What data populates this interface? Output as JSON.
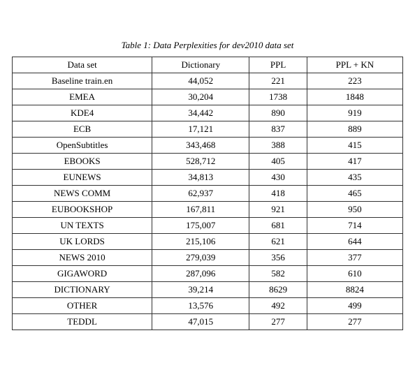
{
  "caption": "Table 1: Data Perplexities for dev2010 data set",
  "columns": [
    "Data set",
    "Dictionary",
    "PPL",
    "PPL + KN"
  ],
  "rows": [
    [
      "Baseline train.en",
      "44,052",
      "221",
      "223"
    ],
    [
      "EMEA",
      "30,204",
      "1738",
      "1848"
    ],
    [
      "KDE4",
      "34,442",
      "890",
      "919"
    ],
    [
      "ECB",
      "17,121",
      "837",
      "889"
    ],
    [
      "OpenSubtitles",
      "343,468",
      "388",
      "415"
    ],
    [
      "EBOOKS",
      "528,712",
      "405",
      "417"
    ],
    [
      "EUNEWS",
      "34,813",
      "430",
      "435"
    ],
    [
      "NEWS COMM",
      "62,937",
      "418",
      "465"
    ],
    [
      "EUBOOKSHOP",
      "167,811",
      "921",
      "950"
    ],
    [
      "UN TEXTS",
      "175,007",
      "681",
      "714"
    ],
    [
      "UK LORDS",
      "215,106",
      "621",
      "644"
    ],
    [
      "NEWS 2010",
      "279,039",
      "356",
      "377"
    ],
    [
      "GIGAWORD",
      "287,096",
      "582",
      "610"
    ],
    [
      "DICTIONARY",
      "39,214",
      "8629",
      "8824"
    ],
    [
      "OTHER",
      "13,576",
      "492",
      "499"
    ],
    [
      "TEDDL",
      "47,015",
      "277",
      "277"
    ]
  ]
}
